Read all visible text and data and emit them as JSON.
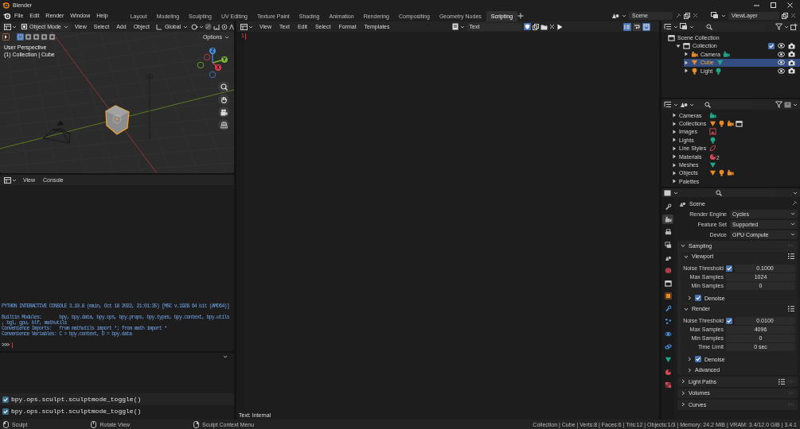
{
  "window": {
    "title": "Blender"
  },
  "menu": [
    "File",
    "Edit",
    "Render",
    "Window",
    "Help"
  ],
  "workspaces": [
    {
      "label": "Layout",
      "selected": false
    },
    {
      "label": "Modeling",
      "selected": false
    },
    {
      "label": "Sculpting",
      "selected": false
    },
    {
      "label": "UV Editing",
      "selected": false
    },
    {
      "label": "Texture Paint",
      "selected": false
    },
    {
      "label": "Shading",
      "selected": false
    },
    {
      "label": "Animation",
      "selected": false
    },
    {
      "label": "Rendering",
      "selected": false
    },
    {
      "label": "Compositing",
      "selected": false
    },
    {
      "label": "Geometry Nodes",
      "selected": false
    },
    {
      "label": "Scripting",
      "selected": true
    }
  ],
  "scene": {
    "label": "Scene"
  },
  "view_layer": {
    "label": "ViewLayer"
  },
  "viewport": {
    "mode": "Object Mode",
    "menus": [
      "View",
      "Select",
      "Add",
      "Object"
    ],
    "orientation": "Global",
    "options": "Options",
    "overlay": [
      "User Perspective",
      "(1) Collection | Cube"
    ],
    "axes": [
      "Z",
      "Y",
      "X"
    ]
  },
  "text_editor": {
    "menus": [
      "View",
      "Text",
      "Edit",
      "Select",
      "Format",
      "Templates"
    ],
    "text_name": "Text",
    "line_number": "1",
    "toggles": [
      {
        "kind": "line_numbers",
        "on": true
      },
      {
        "kind": "word_wrap",
        "on": false
      },
      {
        "kind": "syntax",
        "on": true
      }
    ],
    "footer": "Text: Internal"
  },
  "console": {
    "menus": [
      "View",
      "Console"
    ],
    "banner": "PYTHON INTERACTIVE CONSOLE 3.10.8 (main, Oct 18 2022, 21:01:35) [MSC v.1928 64 bit (AMD64)]",
    "lines": [
      "Builtin Modules:       bpy, bpy.data, bpy.ops, bpy.props, bpy.types, bpy.context, bpy.utils",
      ", bgl, gpu, blf, mathutils",
      "Convenience Imports:   from mathutils import *; from math import *",
      "Convenience Variables: C = bpy.context, D = bpy.data"
    ],
    "prompt": ">>> "
  },
  "info": {
    "entries": [
      "bpy.ops.sculpt.sculptmode_toggle()",
      "bpy.ops.sculpt.sculptmode_toggle()"
    ]
  },
  "outliner": {
    "items": [
      {
        "label": "Scene Collection",
        "kind": "scene_collection",
        "selected": false,
        "children": [
          {
            "label": "Collection",
            "kind": "collection",
            "selected": false,
            "expanded": true,
            "checked": true,
            "children": [
              {
                "label": "Camera",
                "kind": "camera",
                "selected": false,
                "expanded": false
              },
              {
                "label": "Cube",
                "kind": "mesh",
                "selected": true,
                "expanded": false
              },
              {
                "label": "Light",
                "kind": "light",
                "selected": false,
                "expanded": false
              }
            ]
          }
        ]
      }
    ]
  },
  "blend_data": {
    "items": [
      {
        "label": "Cameras",
        "kind": "cameras"
      },
      {
        "label": "Collections",
        "kind": "collections"
      },
      {
        "label": "Images",
        "kind": "images"
      },
      {
        "label": "Lights",
        "kind": "lights"
      },
      {
        "label": "Line Styles",
        "kind": "line_styles"
      },
      {
        "label": "Materials",
        "kind": "materials",
        "count": "2"
      },
      {
        "label": "Meshes",
        "kind": "meshes"
      },
      {
        "label": "Objects",
        "kind": "objects"
      },
      {
        "label": "Palettes",
        "kind": "palettes"
      }
    ]
  },
  "properties": {
    "tabs": [
      {
        "kind": "tool",
        "selected": false
      },
      {
        "kind": "render",
        "selected": true
      },
      {
        "kind": "output",
        "selected": false
      },
      {
        "kind": "view_layer",
        "selected": false
      },
      {
        "kind": "scene",
        "selected": false
      },
      {
        "kind": "world",
        "selected": false
      },
      {
        "kind": "collection",
        "selected": false
      },
      {
        "kind": "object",
        "selected": false
      },
      {
        "kind": "modifiers",
        "selected": false
      },
      {
        "kind": "particles",
        "selected": false
      },
      {
        "kind": "physics",
        "selected": false
      },
      {
        "kind": "constraints",
        "selected": false
      },
      {
        "kind": "data",
        "selected": false
      },
      {
        "kind": "material",
        "selected": false
      },
      {
        "kind": "texture",
        "selected": false
      }
    ],
    "context": "Scene",
    "fields": [
      {
        "label": "Render Engine",
        "value": "Cycles"
      },
      {
        "label": "Feature Set",
        "value": "Supported"
      },
      {
        "label": "Device",
        "value": "GPU Compute"
      }
    ],
    "panels": [
      {
        "label": "Sampling",
        "kind": "panel",
        "expanded": true,
        "presets": false,
        "children": [
          {
            "label": "Viewport",
            "kind": "subpanel",
            "expanded": true,
            "presets": true,
            "rows": [
              {
                "label": "Noise Threshold",
                "kind": "check_number",
                "checked": true,
                "value": "0.1000"
              },
              {
                "label": "Max Samples",
                "kind": "number",
                "value": "1024"
              },
              {
                "label": "Min Samples",
                "kind": "number",
                "value": "0"
              }
            ],
            "children": [
              {
                "label": "Denoise",
                "kind": "toggle",
                "expanded": false,
                "checked": true,
                "presets": false
              }
            ]
          },
          {
            "label": "Render",
            "kind": "subpanel",
            "expanded": true,
            "presets": true,
            "rows": [
              {
                "label": "Noise Threshold",
                "kind": "check_number",
                "checked": true,
                "value": "0.0100"
              },
              {
                "label": "Max Samples",
                "kind": "number",
                "value": "4096"
              },
              {
                "label": "Min Samples",
                "kind": "number",
                "value": "0"
              },
              {
                "label": "Time Limit",
                "kind": "number",
                "value": "0 sec"
              }
            ],
            "children": [
              {
                "label": "Denoise",
                "kind": "toggle",
                "expanded": false,
                "checked": true,
                "presets": false
              },
              {
                "label": "Advanced",
                "kind": "subpanel",
                "expanded": false,
                "presets": false
              }
            ]
          }
        ]
      },
      {
        "label": "Light Paths",
        "kind": "panel",
        "expanded": false,
        "presets": true
      },
      {
        "label": "Volumes",
        "kind": "panel",
        "expanded": false,
        "presets": false
      },
      {
        "label": "Curves",
        "kind": "panel",
        "expanded": false,
        "presets": false
      }
    ]
  },
  "status_bar": {
    "hints": [
      "Sculpt",
      "Rotate View",
      "Sculpt Context Menu"
    ],
    "stats": "Collection | Cube | Verts:8 | Faces:6 | Tris:12 | Objects:1/3 | Memory: 24.2 MiB | VRAM: 3.4/12.0 GiB | 3.4.1"
  }
}
